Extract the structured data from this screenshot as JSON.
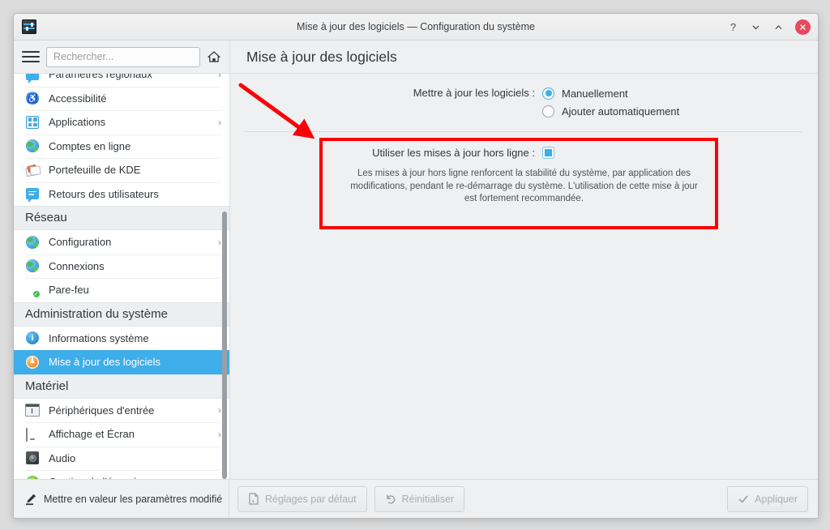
{
  "window": {
    "title": "Mise à jour des logiciels — Configuration du système",
    "app_icon": "system-settings-sliders-icon",
    "controls": {
      "help": "?",
      "minimize": "minimize-icon",
      "maximize": "maximize-icon",
      "close": "close-icon"
    }
  },
  "header": {
    "menu_icon": "hamburger-menu-icon",
    "search_placeholder": "Rechercher...",
    "search_value": "",
    "home_icon": "home-icon",
    "page_title": "Mise à jour des logiciels"
  },
  "sidebar": {
    "items": [
      {
        "type": "item",
        "label": "Paramètres régionaux",
        "icon": "region-icon",
        "chevron": "›",
        "selected": false,
        "partial": true
      },
      {
        "type": "item",
        "label": "Accessibilité",
        "icon": "accessibility-icon",
        "chevron": "",
        "selected": false
      },
      {
        "type": "item",
        "label": "Applications",
        "icon": "applications-grid-icon",
        "chevron": "›",
        "selected": false
      },
      {
        "type": "item",
        "label": "Comptes en ligne",
        "icon": "globe-icon",
        "chevron": "",
        "selected": false
      },
      {
        "type": "item",
        "label": "Portefeuille de KDE",
        "icon": "wallet-icon",
        "chevron": "",
        "selected": false
      },
      {
        "type": "item",
        "label": "Retours des utilisateurs",
        "icon": "feedback-icon",
        "chevron": "",
        "selected": false
      },
      {
        "type": "header",
        "label": "Réseau"
      },
      {
        "type": "item",
        "label": "Configuration",
        "icon": "globe-icon",
        "chevron": "›",
        "selected": false
      },
      {
        "type": "item",
        "label": "Connexions",
        "icon": "globe-icon",
        "chevron": "",
        "selected": false
      },
      {
        "type": "item",
        "label": "Pare-feu",
        "icon": "shield-icon",
        "chevron": "",
        "selected": false
      },
      {
        "type": "header",
        "label": "Administration du système"
      },
      {
        "type": "item",
        "label": "Informations système",
        "icon": "info-icon",
        "chevron": "",
        "selected": false
      },
      {
        "type": "item",
        "label": "Mise à jour des logiciels",
        "icon": "software-update-icon",
        "chevron": "",
        "selected": true
      },
      {
        "type": "header",
        "label": "Matériel"
      },
      {
        "type": "item",
        "label": "Périphériques d'entrée",
        "icon": "input-devices-icon",
        "chevron": "›",
        "selected": false
      },
      {
        "type": "item",
        "label": "Affichage et Écran",
        "icon": "monitor-icon",
        "chevron": "›",
        "selected": false
      },
      {
        "type": "item",
        "label": "Audio",
        "icon": "audio-icon",
        "chevron": "",
        "selected": false
      },
      {
        "type": "item",
        "label": "Gestion de l'énergie",
        "icon": "power-icon",
        "chevron": "›",
        "selected": false
      }
    ]
  },
  "main": {
    "update_mode": {
      "label": "Mettre à jour les logiciels :",
      "options": [
        {
          "label": "Manuellement",
          "checked": true
        },
        {
          "label": "Ajouter automatiquement",
          "checked": false
        }
      ]
    },
    "offline_updates": {
      "label": "Utiliser les mises à jour hors ligne :",
      "checked": true,
      "description": "Les mises à jour hors ligne renforcent la stabilité du système, par application des modifications, pendant le re-démarrage du système. L'utilisation de cette mise à jour est fortement recommandée."
    }
  },
  "footer": {
    "highlight_label": "Mettre en valeur les paramètres modifié",
    "highlight_icon": "highlighter-pen-icon",
    "defaults_label": "Réglages par défaut",
    "defaults_icon": "document-revert-icon",
    "reset_label": "Réinitialiser",
    "reset_icon": "undo-arrow-icon",
    "apply_label": "Appliquer",
    "apply_icon": "checkmark-icon"
  },
  "annotations": {
    "arrow_color": "#fb0007",
    "box_color": "#fb0007"
  },
  "colors": {
    "accent": "#3daee9",
    "window_bg": "#eff0f1",
    "sidebar_bg": "#ffffff",
    "text": "#31363b",
    "close_button": "#e9495e"
  }
}
